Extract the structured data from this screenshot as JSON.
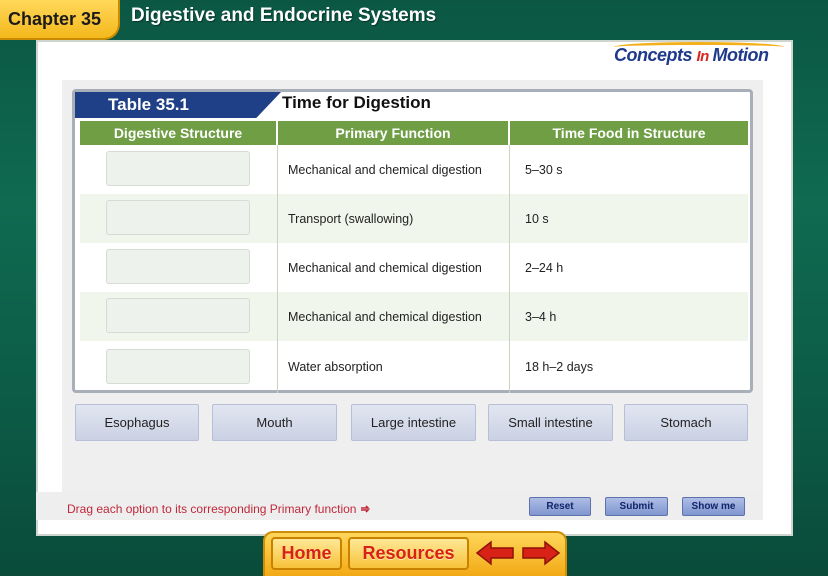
{
  "header": {
    "chapter_label": "Chapter 35",
    "title": "Digestive and Endocrine Systems"
  },
  "logo": {
    "part1": "Concepts ",
    "part2": "In ",
    "part3": "Motion"
  },
  "table": {
    "number": "Table 35.1",
    "title": "Time for Digestion",
    "columns": [
      "Digestive Structure",
      "Primary Function",
      "Time Food in Structure"
    ],
    "rows": [
      {
        "structure": "",
        "function": "Mechanical and chemical digestion",
        "time": "5–30 s"
      },
      {
        "structure": "",
        "function": "Transport (swallowing)",
        "time": "10 s"
      },
      {
        "structure": "",
        "function": "Mechanical and chemical digestion",
        "time": "2–24 h"
      },
      {
        "structure": "",
        "function": "Mechanical and chemical digestion",
        "time": "3–4 h"
      },
      {
        "structure": "",
        "function": "Water absorption",
        "time": "18 h–2 days"
      }
    ]
  },
  "options": [
    "Esophagus",
    "Mouth",
    "Large intestine",
    "Small intestine",
    "Stomach"
  ],
  "instruction": "Drag each option to its corresponding Primary function",
  "controls": {
    "reset": "Reset",
    "submit": "Submit",
    "show_me": "Show me"
  },
  "nav": {
    "home": "Home",
    "resources": "Resources"
  },
  "colors": {
    "frame_green": "#0c5a46",
    "tab_yellow": "#f4b81c",
    "table_banner_blue": "#1f3f86",
    "header_green": "#6f9e45",
    "instruction_red": "#c0283a",
    "nav_red": "#d82216"
  }
}
